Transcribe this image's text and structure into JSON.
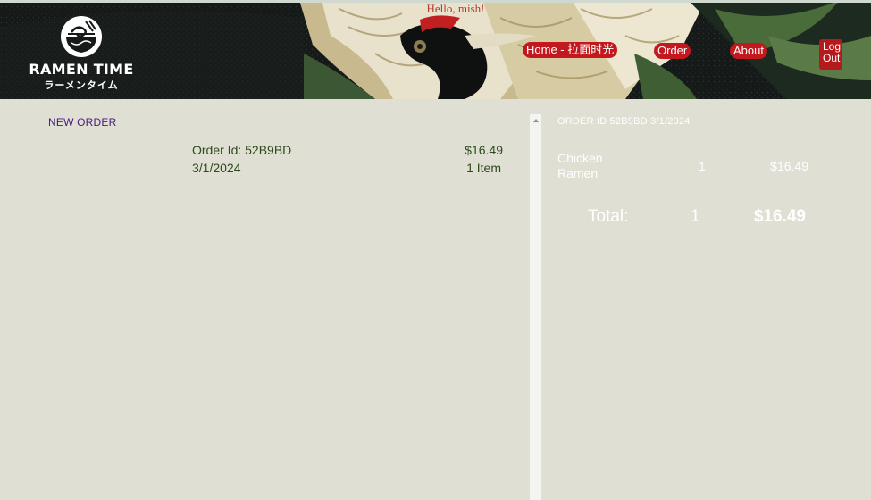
{
  "header": {
    "brand": "RAMEN TIME",
    "brand_sub": "ラーメンタイム",
    "greeting": "Hello, mish!",
    "nav": {
      "home": "Home - 拉面时光",
      "order": "Order",
      "about": "About",
      "logout_1": "Log",
      "logout_2": "Out"
    }
  },
  "orders": {
    "new_order_label": "NEW ORDER",
    "items": [
      {
        "id_label": "Order Id: 52B9BD",
        "date": "3/1/2024",
        "total": "$16.49",
        "items": "1 Item"
      }
    ]
  },
  "detail": {
    "title": "ORDER ID 52B9BD 3/1/2024",
    "lines": [
      {
        "name_1": "Chicken",
        "name_2": "Ramen",
        "qty": "1",
        "price": "$16.49"
      }
    ],
    "total_label": "Total:",
    "total_qty": "1",
    "total_price": "$16.49"
  },
  "colors": {
    "page_bg": "#dfdfd4",
    "nav_pill": "#c3181d",
    "greeting": "#b5392c",
    "new_order_link": "#4a1a7a",
    "order_text": "#2f4a1c",
    "detail_text": "#ffffff"
  },
  "icons": {
    "logo": "ramen-bowl-icon",
    "scroll_up": "arrow-up-icon"
  }
}
